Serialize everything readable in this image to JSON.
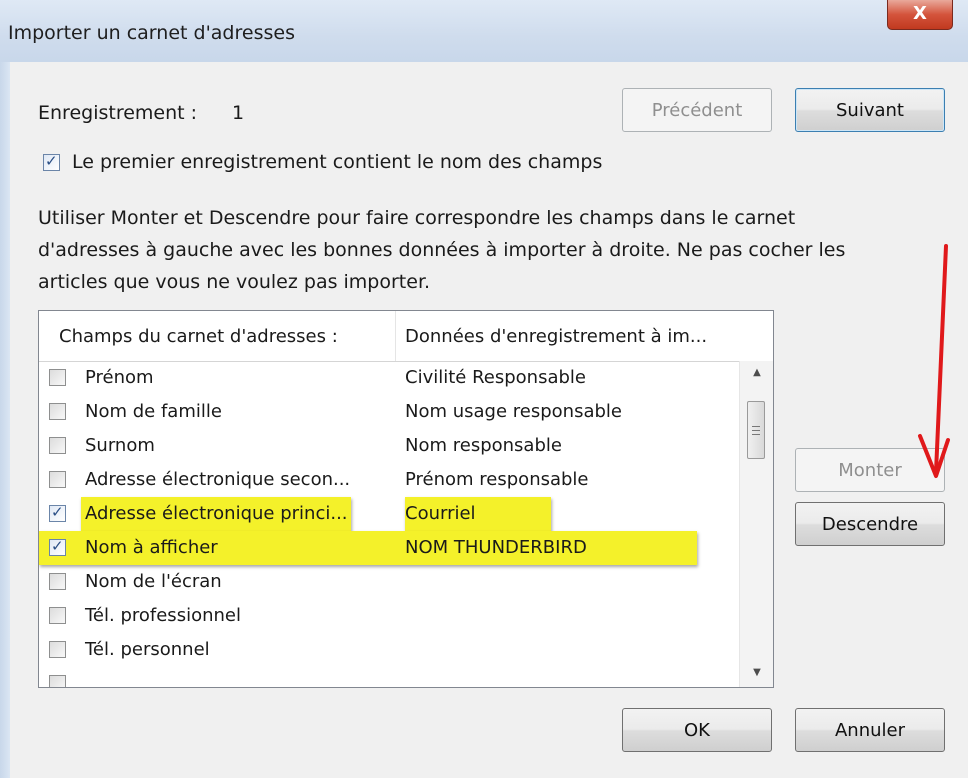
{
  "window": {
    "title": "Importer un carnet d'adresses",
    "close_label": "X"
  },
  "record": {
    "label": "Enregistrement :",
    "number": "1"
  },
  "nav": {
    "previous": "Précédent",
    "next": "Suivant"
  },
  "first_row_checkbox": {
    "checked": true,
    "label": "Le premier enregistrement contient le nom des champs"
  },
  "instructions": {
    "line1": "Utiliser Monter et Descendre pour faire correspondre les champs dans le carnet",
    "line2": "d'adresses à gauche avec les bonnes données à importer à droite. Ne pas cocher les",
    "line3": "articles que vous ne voulez pas importer."
  },
  "table": {
    "headers": [
      "Champs du carnet d'adresses :",
      "Données d'enregistrement à im..."
    ],
    "rows": [
      {
        "field": "Prénom",
        "data": "Civilité Responsable",
        "checked": false
      },
      {
        "field": "Nom de famille",
        "data": "Nom usage responsable",
        "checked": false
      },
      {
        "field": "Surnom",
        "data": "Nom responsable",
        "checked": false
      },
      {
        "field": "Adresse électronique secon...",
        "data": "Prénom responsable",
        "checked": false
      },
      {
        "field": "Adresse électronique princi...",
        "data": "Courriel",
        "checked": true
      },
      {
        "field": "Nom à afficher",
        "data": "NOM THUNDERBIRD",
        "checked": true
      },
      {
        "field": "Nom de l'écran",
        "data": "",
        "checked": false
      },
      {
        "field": "Tél. professionnel",
        "data": "",
        "checked": false
      },
      {
        "field": "Tél. personnel",
        "data": "",
        "checked": false
      }
    ]
  },
  "move": {
    "up": "Monter",
    "down": "Descendre"
  },
  "footer": {
    "ok": "OK",
    "cancel": "Annuler"
  },
  "colors": {
    "highlight": "#f4f12a",
    "arrow": "#e0191b"
  }
}
